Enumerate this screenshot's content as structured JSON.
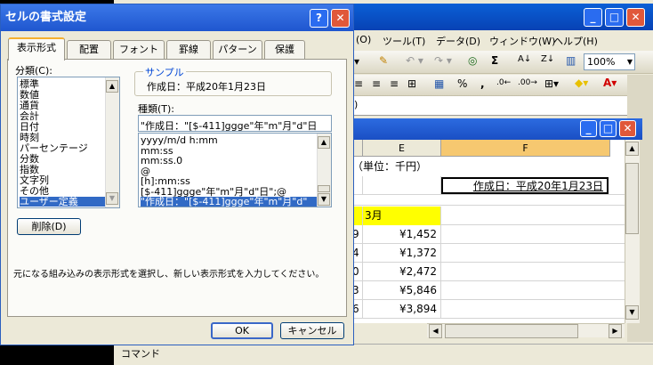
{
  "excel": {
    "menu": [
      "(O)",
      "ツール(T)",
      "データ(D)",
      "ウィンドウ(W)",
      "ヘルプ(H)"
    ],
    "toolbar": {
      "zoom": "100%",
      "comma": ",",
      "sigma": "Σ"
    },
    "formula_paren": ")",
    "columns": [
      "E",
      "F"
    ],
    "unit_label": "（単位：千円）",
    "created_cell": "作成日：平成20年1月23日",
    "march_header": "3月",
    "row_digits": [
      "9",
      "4",
      "0",
      "3",
      "6"
    ],
    "march_values": [
      "¥1,452",
      "¥1,372",
      "¥2,472",
      "¥5,846",
      "¥3,894"
    ],
    "status": "コマンド"
  },
  "dialog": {
    "title": "セルの書式設定",
    "help_btn": "?",
    "close_btn": "✕",
    "tabs": [
      "表示形式",
      "配置",
      "フォント",
      "罫線",
      "パターン",
      "保護"
    ],
    "category_label": "分類(C):",
    "categories": [
      "標準",
      "数値",
      "通貨",
      "会計",
      "日付",
      "時刻",
      "パーセンテージ",
      "分数",
      "指数",
      "文字列",
      "その他",
      "ユーザー定義"
    ],
    "sample_label": "サンプル",
    "sample_value": "作成日：平成20年1月23日",
    "type_label": "種類(T):",
    "type_input": "\"作成日：\"[$-411]ggge\"年\"m\"月\"d\"日",
    "types": [
      "yyyy/m/d h:mm",
      "mm:ss",
      "mm:ss.0",
      "@",
      "[h]:mm:ss",
      "[$-411]ggge\"年\"m\"月\"d\"日\";@",
      "\"作成日：\"[$-411]ggge\"年\"m\"月\"d\""
    ],
    "delete_btn": "削除(D)",
    "description": "元になる組み込みの表示形式を選択し、新しい表示形式を入力してください。",
    "ok_btn": "OK",
    "cancel_btn": "キャンセル"
  }
}
